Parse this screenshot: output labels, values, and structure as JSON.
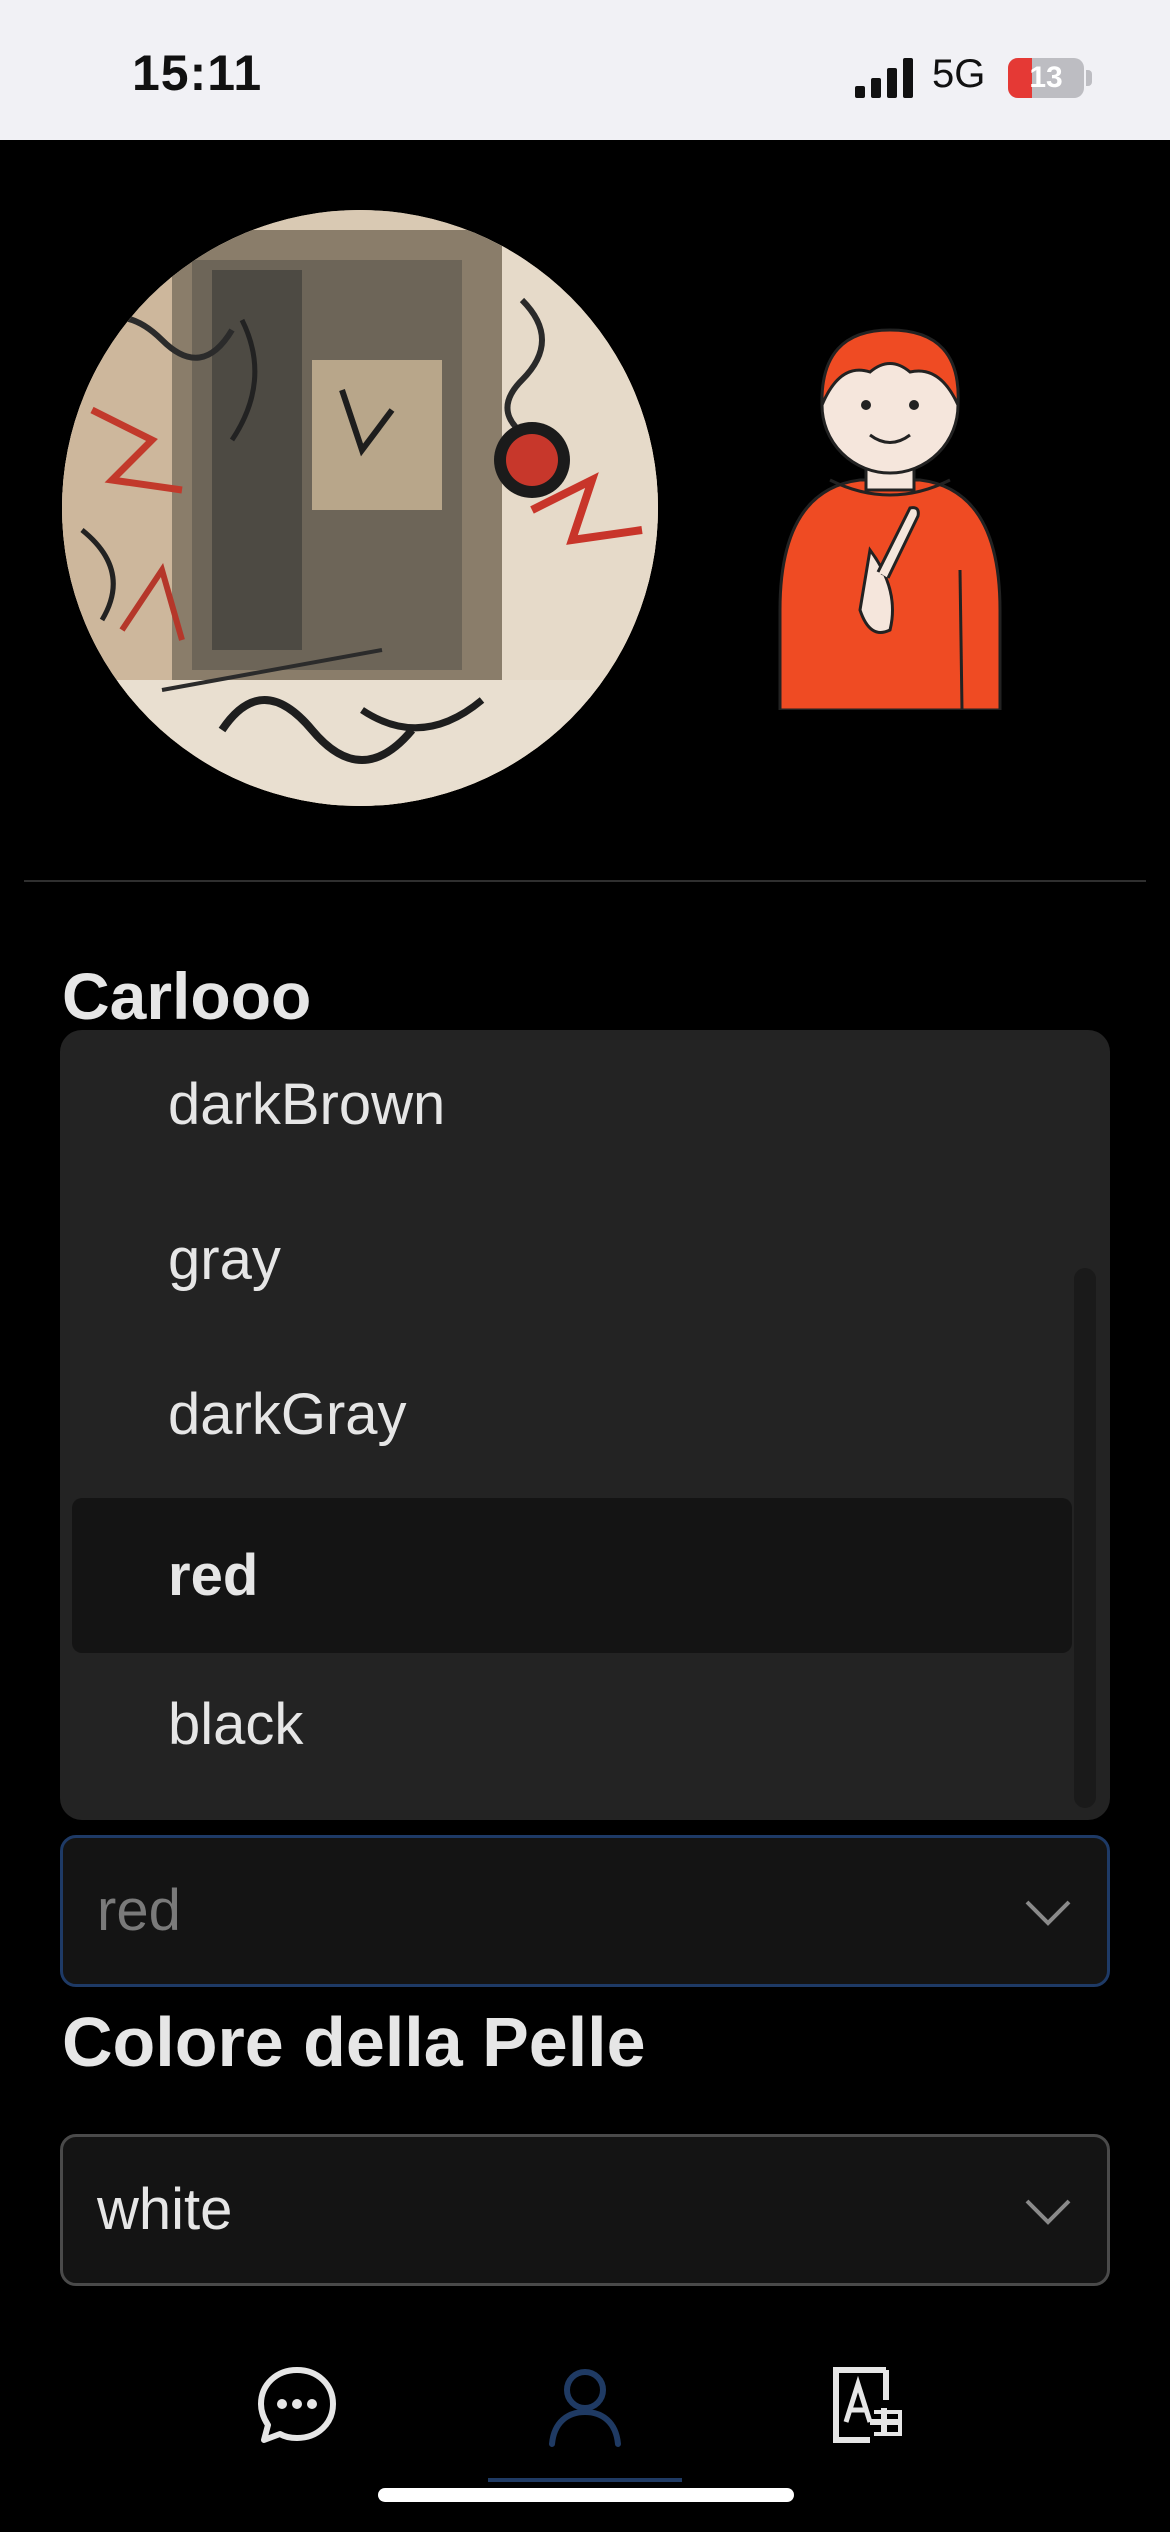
{
  "status_bar": {
    "time": "15:11",
    "network": "5G",
    "battery_level": "13",
    "battery_fraction": 0.13,
    "battery_color": "#e53935"
  },
  "profile": {
    "photo_icon": "profile-photo",
    "pictogram_icon": "person-pointing-self-icon",
    "username": "Carlooo"
  },
  "hair_color_dropdown": {
    "options": [
      "darkBrown",
      "gray",
      "darkGray",
      "red",
      "black"
    ],
    "selected_option": "red",
    "selected_value": "red",
    "border_color": "#1e3a66"
  },
  "skin_color": {
    "label": "Colore della Pelle",
    "selected_value": "white"
  },
  "tab_bar": {
    "items": [
      {
        "icon": "chat-bubble-icon",
        "active": false
      },
      {
        "icon": "person-icon",
        "active": true
      },
      {
        "icon": "translate-icon",
        "active": false
      }
    ],
    "active_color": "#1f3a63",
    "inactive_color": "#e6e6e6"
  }
}
